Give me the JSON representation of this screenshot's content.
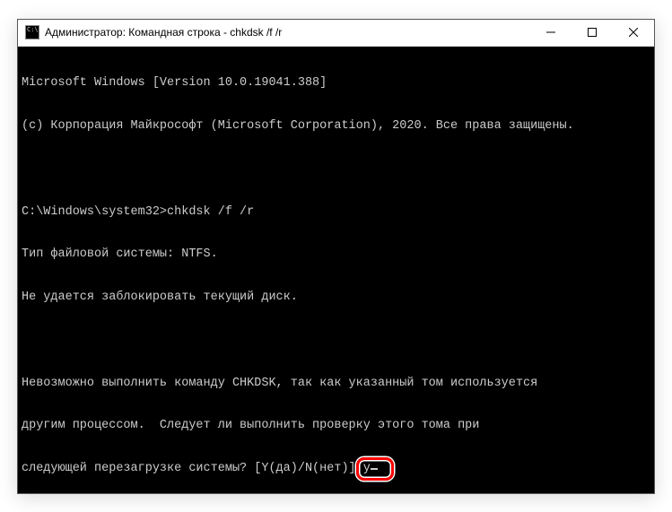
{
  "window": {
    "title": "Администратор: Командная строка - chkdsk  /f /r"
  },
  "terminal": {
    "line1": "Microsoft Windows [Version 10.0.19041.388]",
    "line2": "(c) Корпорация Майкрософт (Microsoft Corporation), 2020. Все права защищены.",
    "prompt": "C:\\Windows\\system32>",
    "command": "chkdsk /f /r",
    "out1": "Тип файловой системы: NTFS.",
    "out2": "Не удается заблокировать текущий диск.",
    "out3": "Невозможно выполнить команду CHKDSK, так как указанный том используется",
    "out4": "другим процессом.  Следует ли выполнить проверку этого тома при",
    "out5": "следующей перезагрузке системы? [Y(да)/N(нет)] ",
    "user_input": "y"
  }
}
